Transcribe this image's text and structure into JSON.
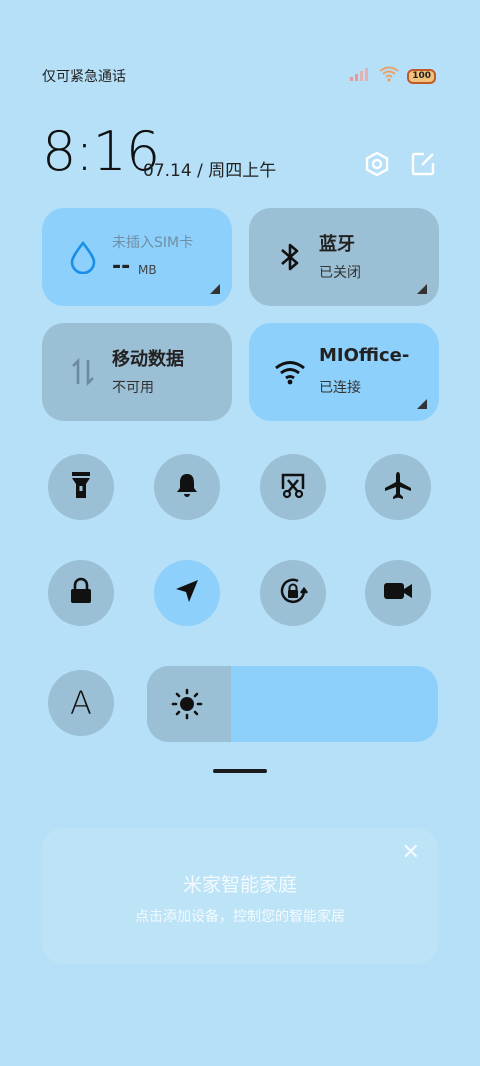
{
  "status_bar": {
    "carrier_text": "仅可紧急通话",
    "battery_level": "100",
    "icons": [
      "signal-icon",
      "wifi-icon",
      "battery-icon"
    ]
  },
  "header": {
    "time": "8:16",
    "date": "07.14 / 周四上午",
    "icons": [
      "settings-icon",
      "edit-icon"
    ]
  },
  "tiles": [
    {
      "name": "data-usage",
      "title": "未插入SIM卡",
      "value": "--",
      "unit": "MB",
      "active": true,
      "icon": "water-drop-icon"
    },
    {
      "name": "bluetooth",
      "title": "蓝牙",
      "subtitle": "已关闭",
      "active": false,
      "icon": "bluetooth-icon"
    },
    {
      "name": "mobile-data",
      "title": "移动数据",
      "subtitle": "不可用",
      "active": false,
      "icon": "data-transfer-icon"
    },
    {
      "name": "wifi",
      "title": "MIOffice-",
      "subtitle": "已连接",
      "active": true,
      "icon": "wifi-icon"
    }
  ],
  "toggles_row1": [
    {
      "name": "flashlight",
      "icon": "flashlight-icon",
      "active": false
    },
    {
      "name": "ring",
      "icon": "bell-icon",
      "active": false
    },
    {
      "name": "screenshot",
      "icon": "screenshot-icon",
      "active": false
    },
    {
      "name": "airplane",
      "icon": "airplane-icon",
      "active": false
    }
  ],
  "toggles_row2": [
    {
      "name": "lock-screen",
      "icon": "lock-icon",
      "active": false
    },
    {
      "name": "location",
      "icon": "location-arrow-icon",
      "active": true
    },
    {
      "name": "rotation-lock",
      "icon": "rotation-lock-icon",
      "active": false
    },
    {
      "name": "screen-record",
      "icon": "video-camera-icon",
      "active": false
    }
  ],
  "font_toggle": {
    "label": "A"
  },
  "brightness": {
    "level": 0.29,
    "icon": "sun-icon"
  },
  "smart_home_card": {
    "title": "米家智能家庭",
    "subtitle": "点击添加设备，控制您的智能家居",
    "close_icon": "close-icon"
  },
  "colors": {
    "background": "#b5e0f7",
    "active_tile": "#8dd0fb",
    "inactive_tile": "#9bbfd4"
  }
}
